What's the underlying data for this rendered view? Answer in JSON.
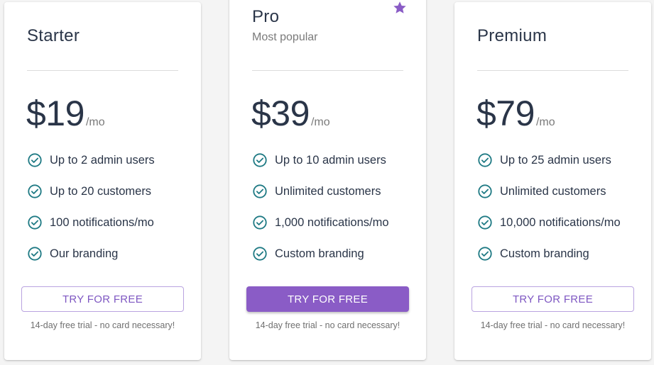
{
  "colors": {
    "accent": "#8a5cc6",
    "check": "#1f7a84",
    "text": "#2a3548",
    "muted": "#7a7a7a"
  },
  "plans": [
    {
      "name": "Starter",
      "subtitle": "",
      "price": "$19",
      "period": "/mo",
      "features": [
        "Up to 2 admin users",
        "Up to 20 customers",
        "100 notifications/mo",
        "Our branding"
      ],
      "cta": "TRY FOR FREE",
      "cta_style": "outline",
      "note": "14-day free trial - no card necessary!"
    },
    {
      "name": "Pro",
      "subtitle": "Most popular",
      "badge_icon": "star-icon",
      "price": "$39",
      "period": "/mo",
      "features": [
        "Up to 10 admin users",
        "Unlimited customers",
        "1,000 notifications/mo",
        "Custom branding"
      ],
      "cta": "TRY FOR FREE",
      "cta_style": "filled",
      "note": "14-day free trial - no card necessary!"
    },
    {
      "name": "Premium",
      "subtitle": "",
      "price": "$79",
      "period": "/mo",
      "features": [
        "Up to 25 admin users",
        "Unlimited customers",
        "10,000 notifications/mo",
        "Custom branding"
      ],
      "cta": "TRY FOR FREE",
      "cta_style": "outline",
      "note": "14-day free trial - no card necessary!"
    }
  ]
}
